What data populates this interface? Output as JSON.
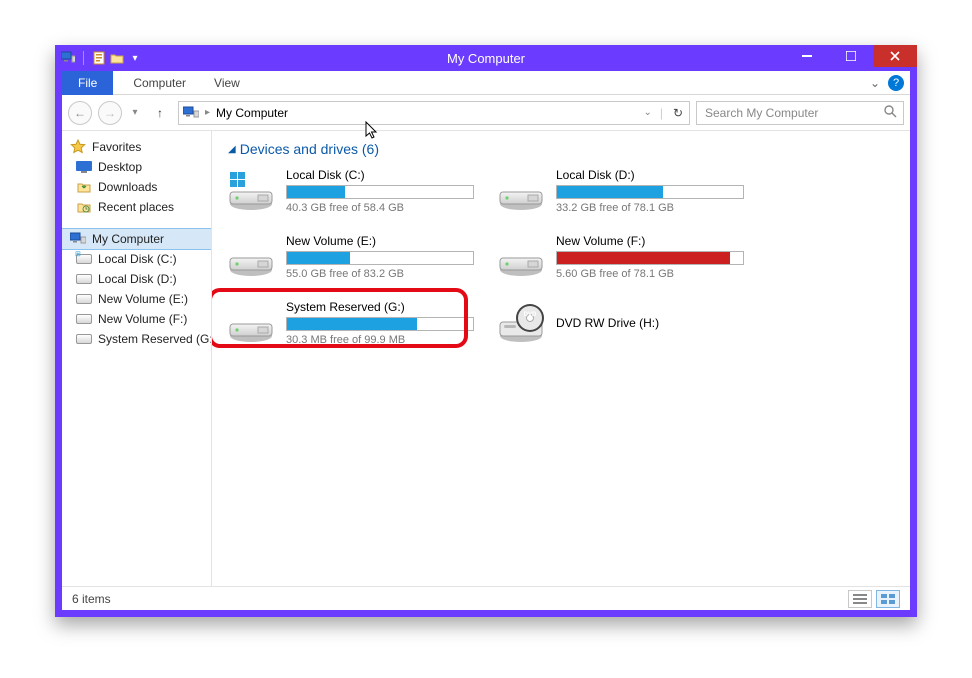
{
  "window": {
    "title": "My Computer"
  },
  "ribbon": {
    "tabs": {
      "file": "File",
      "computer": "Computer",
      "view": "View"
    }
  },
  "address": {
    "current": "My Computer",
    "search_placeholder": "Search My Computer"
  },
  "sidebar": {
    "fav_header": "Favorites",
    "favorites": [
      {
        "label": "Desktop"
      },
      {
        "label": "Downloads"
      },
      {
        "label": "Recent places"
      }
    ],
    "computer_header": "My Computer",
    "drives": [
      {
        "label": "Local Disk (C:)"
      },
      {
        "label": "Local Disk (D:)"
      },
      {
        "label": "New Volume (E:)"
      },
      {
        "label": "New Volume (F:)"
      },
      {
        "label": "System Reserved (G:)"
      }
    ]
  },
  "section": {
    "title": "Devices and drives (6)"
  },
  "drives": [
    {
      "name": "Local Disk (C:)",
      "free": "40.3 GB free of 58.4 GB",
      "fill_pct": 31,
      "color": "#1ea1e0",
      "os_drive": true
    },
    {
      "name": "Local Disk (D:)",
      "free": "33.2 GB free of 78.1 GB",
      "fill_pct": 57,
      "color": "#1ea1e0",
      "os_drive": false
    },
    {
      "name": "New Volume (E:)",
      "free": "55.0 GB free of 83.2 GB",
      "fill_pct": 34,
      "color": "#1ea1e0",
      "os_drive": false
    },
    {
      "name": "New Volume (F:)",
      "free": "5.60 GB free of 78.1 GB",
      "fill_pct": 93,
      "color": "#cc1f1f",
      "os_drive": false
    },
    {
      "name": "System Reserved (G:)",
      "free": "30.3 MB free of 99.9 MB",
      "fill_pct": 70,
      "color": "#1ea1e0",
      "os_drive": false
    }
  ],
  "dvd": {
    "name": "DVD RW Drive (H:)"
  },
  "status": {
    "count": "6 items"
  }
}
